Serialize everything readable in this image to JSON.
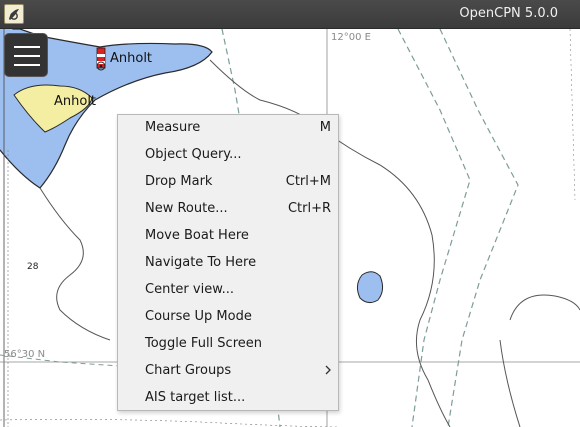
{
  "window": {
    "title": "OpenCPN 5.0.0"
  },
  "chart": {
    "places": [
      {
        "name": "Anholt"
      },
      {
        "name": "Anholt"
      }
    ],
    "longitude_label": "12°00 E",
    "latitude_label": "56°30 N",
    "depth_sounding": "28",
    "colors": {
      "land": "#f3eea2",
      "shallow_water": "#9dbff0",
      "deep_water": "#ffffff",
      "contour": "#555555",
      "route_dashed": "#7d9c9a",
      "grid": "#8a8a8a"
    }
  },
  "context_menu": {
    "items": [
      {
        "label": "Measure",
        "shortcut": "M"
      },
      {
        "label": "Object Query...",
        "shortcut": ""
      },
      {
        "label": "Drop Mark",
        "shortcut": "Ctrl+M"
      },
      {
        "label": "New Route...",
        "shortcut": "Ctrl+R"
      },
      {
        "label": "Move Boat Here",
        "shortcut": ""
      },
      {
        "label": "Navigate To Here",
        "shortcut": ""
      },
      {
        "label": "Center view...",
        "shortcut": ""
      },
      {
        "label": "Course Up Mode",
        "shortcut": ""
      },
      {
        "label": "Toggle Full Screen",
        "shortcut": ""
      },
      {
        "label": "Chart Groups",
        "shortcut": "",
        "submenu": true
      },
      {
        "label": "AIS target list...",
        "shortcut": ""
      }
    ]
  },
  "toolbar": {
    "menu_icon": "hamburger-menu-icon"
  }
}
